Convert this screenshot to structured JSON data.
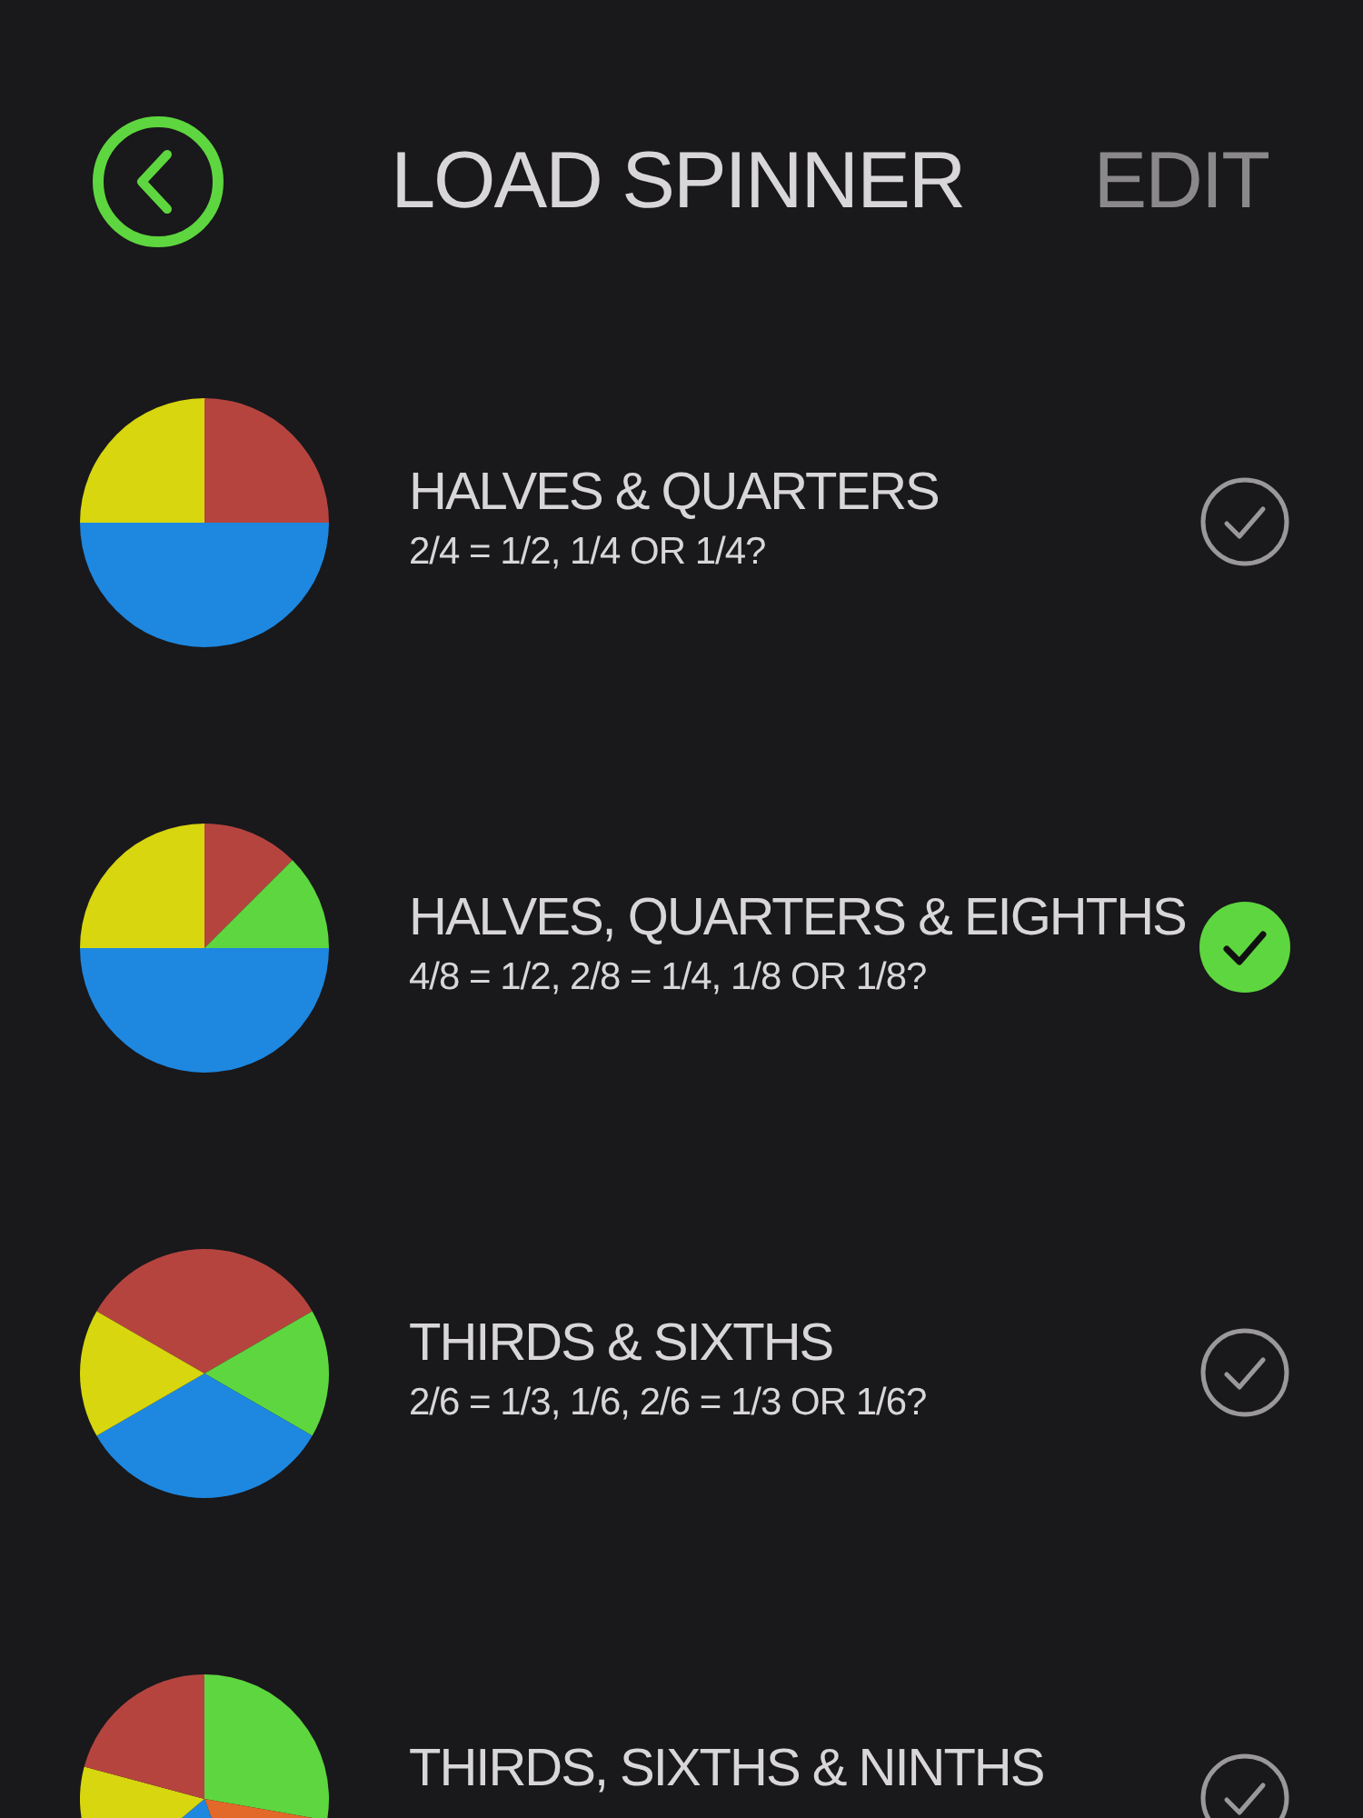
{
  "header": {
    "title": "LOAD SPINNER",
    "action": "EDIT"
  },
  "spinners": [
    {
      "title": "HALVES & QUARTERS",
      "subtitle": "2/4 = 1/2, 1/4 OR 1/4?",
      "selected": false
    },
    {
      "title": "HALVES, QUARTERS & EIGHTHS",
      "subtitle": "4/8 = 1/2, 2/8 = 1/4, 1/8 OR 1/8?",
      "selected": true
    },
    {
      "title": "THIRDS & SIXTHS",
      "subtitle": "2/6 = 1/3, 1/6, 2/6 = 1/3 OR 1/6?",
      "selected": false
    },
    {
      "title": "THIRDS, SIXTHS & NINTHS",
      "selected": false
    }
  ]
}
